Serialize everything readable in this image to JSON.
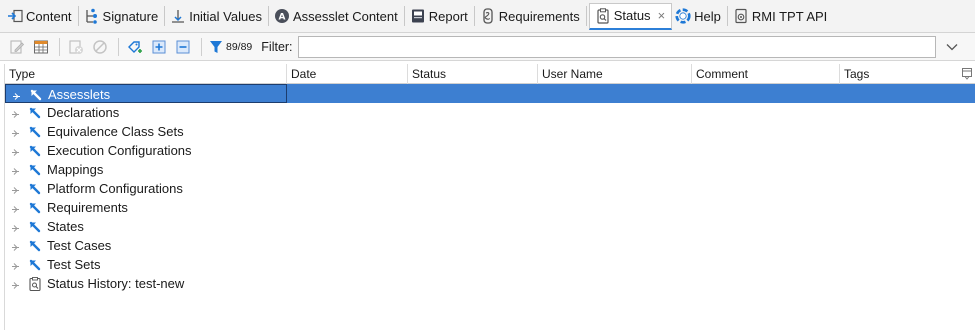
{
  "tabs": [
    {
      "label": "Content",
      "icon": "content-icon"
    },
    {
      "label": "Signature",
      "icon": "signature-icon"
    },
    {
      "label": "Initial Values",
      "icon": "initial-values-icon"
    },
    {
      "label": "Assesslet Content",
      "icon": "assesslet-icon"
    },
    {
      "label": "Report",
      "icon": "report-icon"
    },
    {
      "label": "Requirements",
      "icon": "requirements-icon"
    },
    {
      "label": "Status",
      "icon": "status-icon",
      "active": true,
      "close": "×"
    },
    {
      "label": "Help",
      "icon": "help-icon"
    },
    {
      "label": "RMI TPT API",
      "icon": "api-icon"
    }
  ],
  "toolbar": {
    "filter_count": "89/89",
    "filter_label": "Filter:",
    "filter_value": ""
  },
  "table": {
    "columns": [
      "Type",
      "Date",
      "Status",
      "User Name",
      "Comment",
      "Tags"
    ],
    "rows": [
      {
        "label": "Assesslets",
        "icon": "status-arrow-icon",
        "selected": true
      },
      {
        "label": "Declarations",
        "icon": "status-arrow-icon"
      },
      {
        "label": "Equivalence Class Sets",
        "icon": "status-arrow-icon"
      },
      {
        "label": "Execution Configurations",
        "icon": "status-arrow-icon"
      },
      {
        "label": "Mappings",
        "icon": "status-arrow-icon"
      },
      {
        "label": "Platform Configurations",
        "icon": "status-arrow-icon"
      },
      {
        "label": "Requirements",
        "icon": "status-arrow-icon"
      },
      {
        "label": "States",
        "icon": "status-arrow-icon"
      },
      {
        "label": "Test Cases",
        "icon": "status-arrow-icon"
      },
      {
        "label": "Test Sets",
        "icon": "status-arrow-icon"
      },
      {
        "label": "Status History: test-new",
        "icon": "status-history-icon"
      }
    ]
  },
  "colors": {
    "selection": "#3d7fd1",
    "accent_blue": "#1e78d6",
    "active_tab_underline": "#2c7fd8"
  }
}
